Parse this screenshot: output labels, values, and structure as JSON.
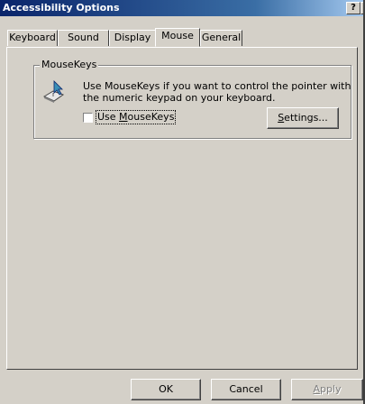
{
  "window": {
    "title": "Accessibility Options",
    "help_button": "?",
    "close_button": "×"
  },
  "tabs": [
    {
      "label": "Keyboard",
      "active": false
    },
    {
      "label": "Sound",
      "active": false
    },
    {
      "label": "Display",
      "active": false
    },
    {
      "label": "Mouse",
      "active": true
    },
    {
      "label": "General",
      "active": false
    }
  ],
  "mousekeys": {
    "group_label": "MouseKeys",
    "icon": "mouse-pointer-icon",
    "description_line1": "Use MouseKeys if you want to control the pointer with",
    "description_line2": "the numeric keypad on your keyboard.",
    "checkbox_label_prefix": "Use ",
    "checkbox_label_accel": "M",
    "checkbox_label_rest": "ouseKeys",
    "checkbox_checked": false,
    "settings_accel": "S",
    "settings_rest": "ettings..."
  },
  "footer": {
    "ok": "OK",
    "cancel": "Cancel",
    "apply_accel": "A",
    "apply_rest": "pply",
    "apply_disabled": true
  }
}
